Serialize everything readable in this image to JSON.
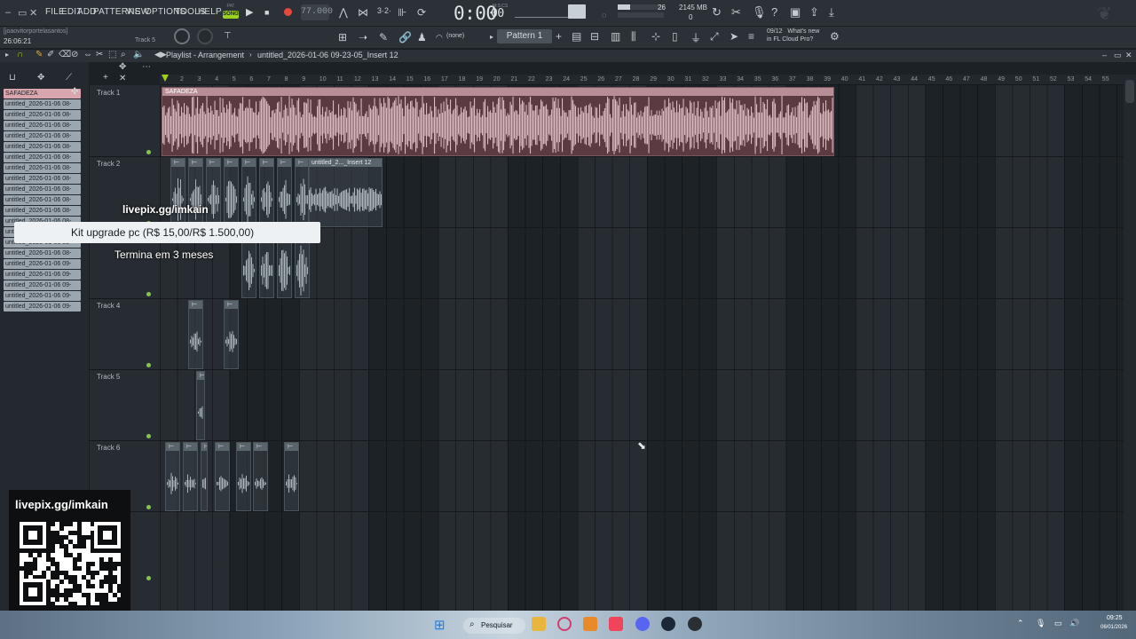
{
  "window": {
    "menu": [
      "FILE",
      "EDIT",
      "ADD",
      "PATTERNS",
      "VIEW",
      "OPTIONS",
      "TOOLS",
      "HELP"
    ],
    "song_mode": "SONG",
    "pattern_mode": "PAT",
    "tempo": "77.000",
    "time": "0:00",
    "time_ms": "00",
    "time_format": "M:S:CS",
    "cpu": "26",
    "memory": "2145 MB",
    "memory2": "0",
    "user": "[joaovitorportelasantos]",
    "clock": "26:06:21",
    "hint_track": "Track 5",
    "snap": "(none)",
    "pattern": "Pattern 1",
    "news_date": "09/12",
    "news_text": "What's new",
    "news_text2": "in FL Cloud Pro?"
  },
  "playlist": {
    "title": "Playlist - Arrangement",
    "path": "untitled_2026-01-06 09-23-05_Insert 12",
    "picker_first": "SAFADEZA",
    "picker_items": [
      "untitled_2026-01-06 08-",
      "untitled_2026-01-06 08-",
      "untitled_2026-01-06 08-",
      "untitled_2026-01-06 08-",
      "untitled_2026-01-06 08-",
      "untitled_2026-01-06 08-",
      "untitled_2026-01-06 08-",
      "untitled_2026-01-06 08-",
      "untitled_2026-01-06 08-",
      "untitled_2026-01-06 08-",
      "untitled_2026-01-06 08-",
      "untitled_2026-01-06 08-",
      "untitled_2026-01-06 08-",
      "untitled_2026-01-06 08-",
      "untitled_2026-01-06 08-",
      "untitled_2026-01-06 09-",
      "untitled_2026-01-06 09-",
      "untitled_2026-01-06 09-",
      "untitled_2026-01-06 09-",
      "untitled_2026-01-06 09-"
    ],
    "tracks": [
      "Track 1",
      "Track 2",
      "Track 3",
      "Track 4",
      "Track 5",
      "Track 6",
      ""
    ],
    "ruler": [
      "2",
      "3",
      "4",
      "5",
      "6",
      "7",
      "8",
      "9",
      "10",
      "11",
      "12",
      "13",
      "14",
      "15",
      "16",
      "17",
      "18",
      "19",
      "20",
      "21",
      "22",
      "23",
      "24",
      "25",
      "26",
      "27",
      "28",
      "29",
      "30",
      "31",
      "32",
      "33",
      "34",
      "35",
      "36",
      "37",
      "38",
      "39",
      "40",
      "41",
      "42",
      "43",
      "44",
      "45",
      "46",
      "47",
      "48",
      "49",
      "50",
      "51",
      "52",
      "53",
      "54",
      "55"
    ],
    "big_clip_label": "SAFADEZA",
    "track2_clip_label": "untitled_2..._Insert 12"
  },
  "overlay": {
    "donate_link": "livepix.gg/imkain",
    "goal": "Kit upgrade pc (R$ 15,00/R$ 1.500,00)",
    "goal_end": "Termina em 3 meses",
    "qr_label": "livepix.gg/imkain"
  },
  "taskbar": {
    "search": "Pesquisar",
    "time": "09:25",
    "date": "06/01/2026"
  },
  "colors": {
    "accent_green": "#9ad21e",
    "clip_pink": "#d9a6ad",
    "record_red": "#e6483e"
  }
}
